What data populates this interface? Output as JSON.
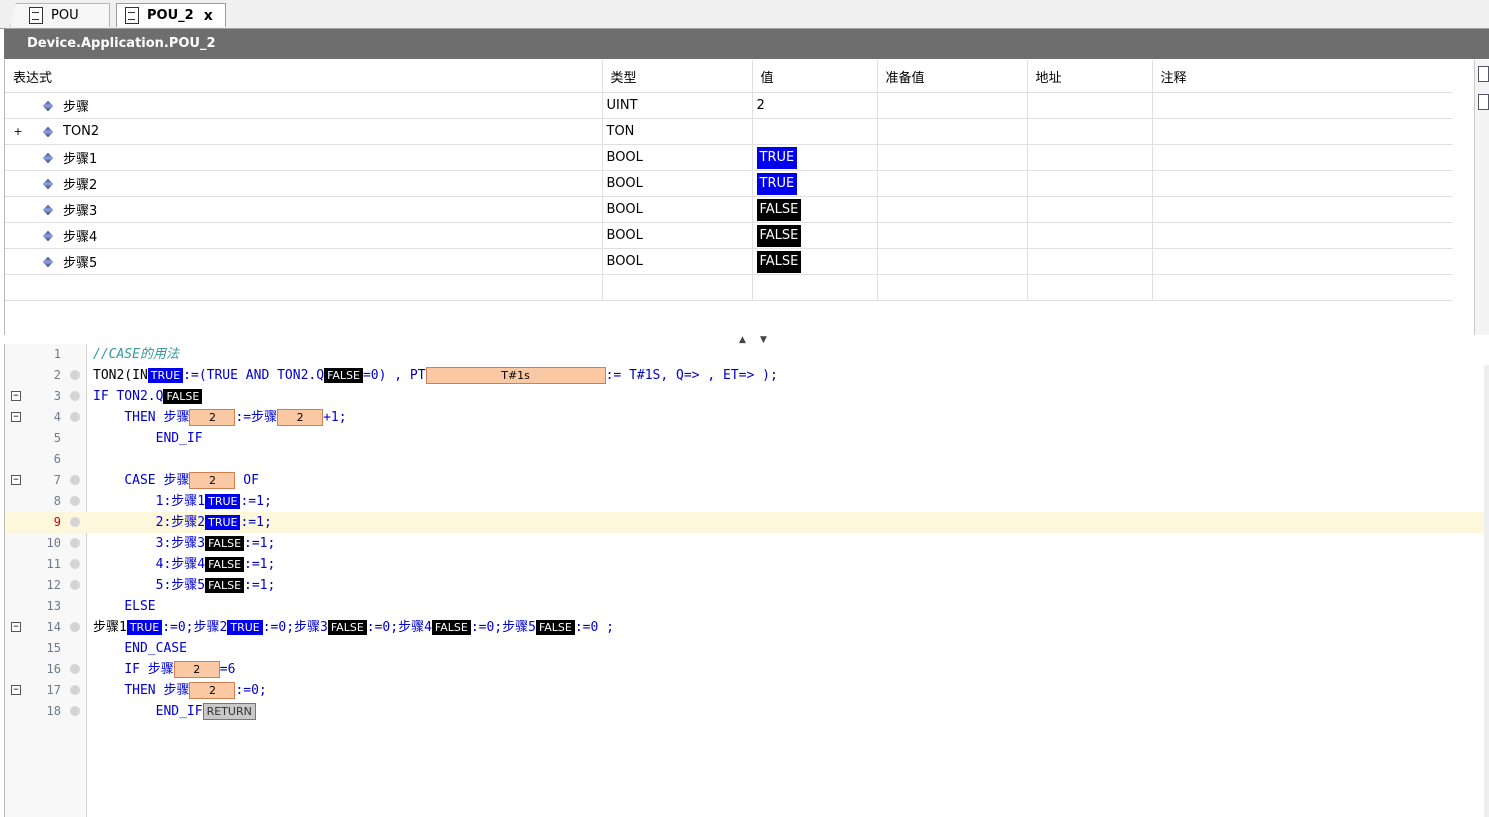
{
  "tabs": [
    {
      "label": "POU",
      "active": false
    },
    {
      "label": "POU_2",
      "active": true,
      "close": "x"
    }
  ],
  "path": "Device.Application.POU_2",
  "watch": {
    "columns": [
      "表达式",
      "类型",
      "值",
      "准备值",
      "地址",
      "注释"
    ],
    "rows": [
      {
        "expander": "",
        "name": "步骤",
        "type": "UINT",
        "value": "2",
        "value_kind": "plain"
      },
      {
        "expander": "+",
        "name": "TON2",
        "type": "TON",
        "value": "",
        "value_kind": "plain"
      },
      {
        "expander": "",
        "name": "步骤1",
        "type": "BOOL",
        "value": "TRUE",
        "value_kind": "true"
      },
      {
        "expander": "",
        "name": "步骤2",
        "type": "BOOL",
        "value": "TRUE",
        "value_kind": "true"
      },
      {
        "expander": "",
        "name": "步骤3",
        "type": "BOOL",
        "value": "FALSE",
        "value_kind": "false"
      },
      {
        "expander": "",
        "name": "步骤4",
        "type": "BOOL",
        "value": "FALSE",
        "value_kind": "false"
      },
      {
        "expander": "",
        "name": "步骤5",
        "type": "BOOL",
        "value": "FALSE",
        "value_kind": "false"
      }
    ]
  },
  "code": {
    "line_numbers": [
      "1",
      "2",
      "3",
      "4",
      "5",
      "6",
      "7",
      "8",
      "9",
      "10",
      "11",
      "12",
      "13",
      "14",
      "15",
      "16",
      "17",
      "18"
    ],
    "l1_comment": "//CASE的用法",
    "l2": {
      "a": "TON2(IN",
      "in_val": "TRUE",
      "b": ":=(TRUE AND TON2.Q",
      "q_val": "FALSE",
      "c": "=0) , PT",
      "pt_val": "T#1s",
      "d": ":= T#1S, Q=> , ET=> );"
    },
    "l3": {
      "a": "IF TON2.Q",
      "q_val": "FALSE"
    },
    "l4": {
      "a": "THEN 步骤",
      "v1": "2",
      "b": ":=步骤",
      "v2": "2",
      "c": "+1;"
    },
    "l5": "END_IF",
    "l7": {
      "a": "CASE 步骤",
      "v": "2",
      "b": " OF"
    },
    "l8": {
      "a": "1:步骤1",
      "v": "TRUE",
      "b": ":=1;"
    },
    "l9": {
      "a": "2:步骤2",
      "v": "TRUE",
      "b": ":=1;"
    },
    "l10": {
      "a": "3:步骤3",
      "v": "FALSE",
      "b": ":=1;"
    },
    "l11": {
      "a": "4:步骤4",
      "v": "FALSE",
      "b": ":=1;"
    },
    "l12": {
      "a": "5:步骤5",
      "v": "FALSE",
      "b": ":=1;"
    },
    "l13": "ELSE",
    "l14": {
      "a": "步骤1",
      "v1": "TRUE",
      "b": ":=0;步骤2",
      "v2": "TRUE",
      "c": ":=0;步骤3",
      "v3": "FALSE",
      "d": ":=0;步骤4",
      "v4": "FALSE",
      "e": ":=0;步骤5",
      "v5": "FALSE",
      "f": ":=0 ;"
    },
    "l15": "END_CASE",
    "l16": {
      "a": "IF 步骤",
      "v": "2",
      "b": "=6"
    },
    "l17": {
      "a": "THEN 步骤",
      "v": "2",
      "b": ":=0;"
    },
    "l18": {
      "a": "END_IF",
      "ret": "RETURN"
    }
  }
}
